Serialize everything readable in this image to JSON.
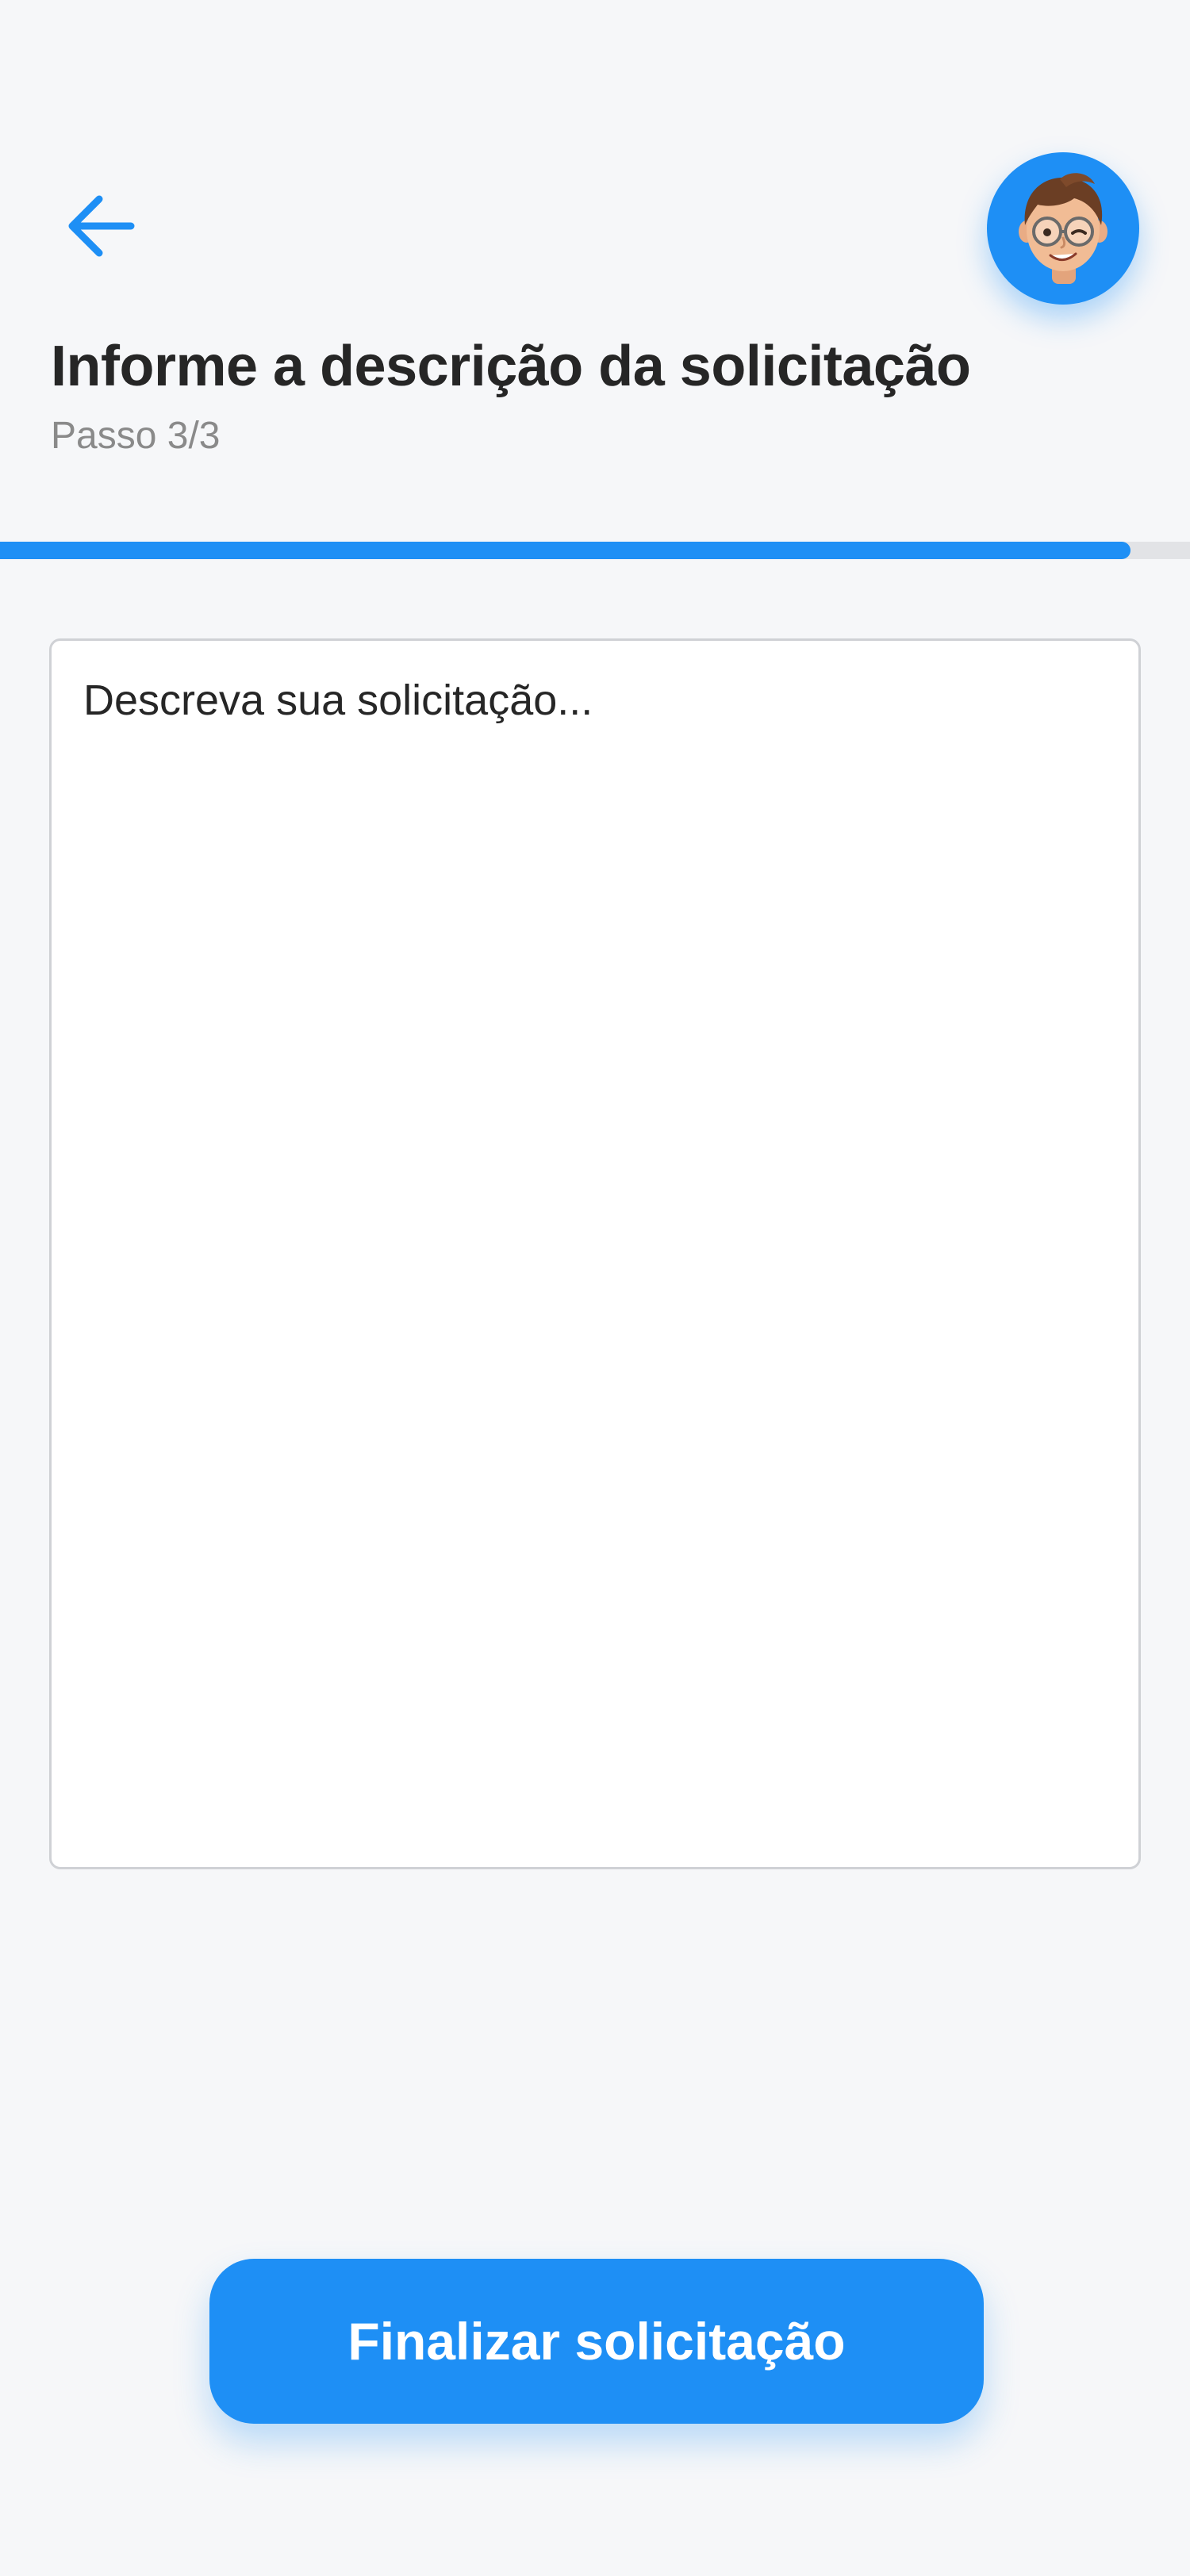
{
  "header": {
    "back_icon": "arrow-left-icon",
    "avatar_icon": "memoji-avatar",
    "title": "Informe a descrição da solicitação",
    "step": "Passo 3/3"
  },
  "progress": {
    "value": 0.95
  },
  "form": {
    "description_placeholder": "Descreva sua solicitação...",
    "description_value": ""
  },
  "actions": {
    "finish_label": "Finalizar solicitação"
  },
  "colors": {
    "accent": "#1e8ff5",
    "background": "#f6f7f9",
    "title_text": "#262626",
    "muted_text": "#8a8a8a",
    "track": "#e2e3e6"
  }
}
